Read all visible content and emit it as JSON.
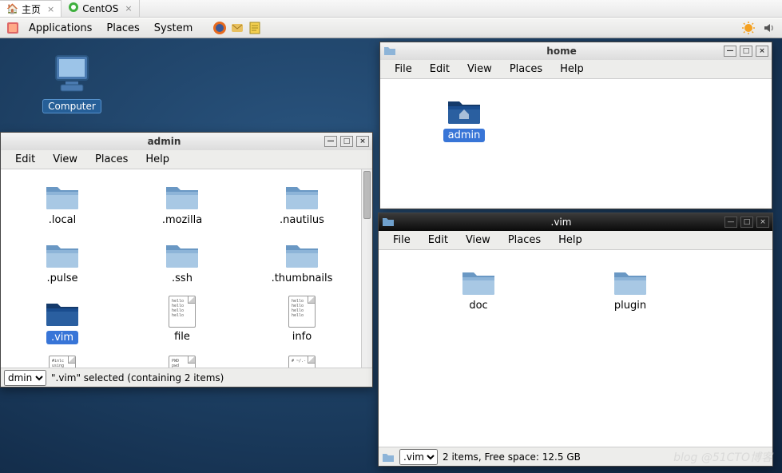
{
  "browser_tabs": [
    {
      "label": "主页",
      "icon": "home-icon"
    },
    {
      "label": "CentOS",
      "icon": "centos-icon"
    }
  ],
  "gnome_panel": {
    "menus": [
      "Applications",
      "Places",
      "System"
    ]
  },
  "desktop": {
    "computer_label": "Computer",
    "watermark": "blog @51CTO博客"
  },
  "win_admin": {
    "title": "admin",
    "menus": [
      "Edit",
      "View",
      "Places",
      "Help"
    ],
    "items": [
      {
        "name": ".local",
        "type": "folder"
      },
      {
        "name": ".mozilla",
        "type": "folder"
      },
      {
        "name": ".nautilus",
        "type": "folder"
      },
      {
        "name": ".pulse",
        "type": "folder"
      },
      {
        "name": ".ssh",
        "type": "folder"
      },
      {
        "name": ".thumbnails",
        "type": "folder"
      },
      {
        "name": ".vim",
        "type": "folder",
        "selected": true
      },
      {
        "name": "file",
        "type": "text",
        "preview": "hello\nhello\nhello\nhello"
      },
      {
        "name": "info",
        "type": "text",
        "preview": "hello\nhello\nhello\nhello"
      },
      {
        "name": "",
        "type": "text",
        "preview": "#inlc\nusing\nint m"
      },
      {
        "name": "",
        "type": "text",
        "preview": "PWD\npwd\necho"
      },
      {
        "name": "",
        "type": "text",
        "preview": "# ~/.-"
      }
    ],
    "status_select": "dmin",
    "status_text": "\".vim\" selected (containing 2 items)"
  },
  "win_home": {
    "title": "home",
    "menus": [
      "File",
      "Edit",
      "View",
      "Places",
      "Help"
    ],
    "items": [
      {
        "name": "admin",
        "type": "folder-home",
        "selected": true
      }
    ]
  },
  "win_vim": {
    "title": ".vim",
    "menus": [
      "File",
      "Edit",
      "View",
      "Places",
      "Help"
    ],
    "items": [
      {
        "name": "doc",
        "type": "folder"
      },
      {
        "name": "plugin",
        "type": "folder"
      }
    ],
    "status_select": ".vim",
    "status_text": "2 items, Free space: 12.5 GB"
  }
}
